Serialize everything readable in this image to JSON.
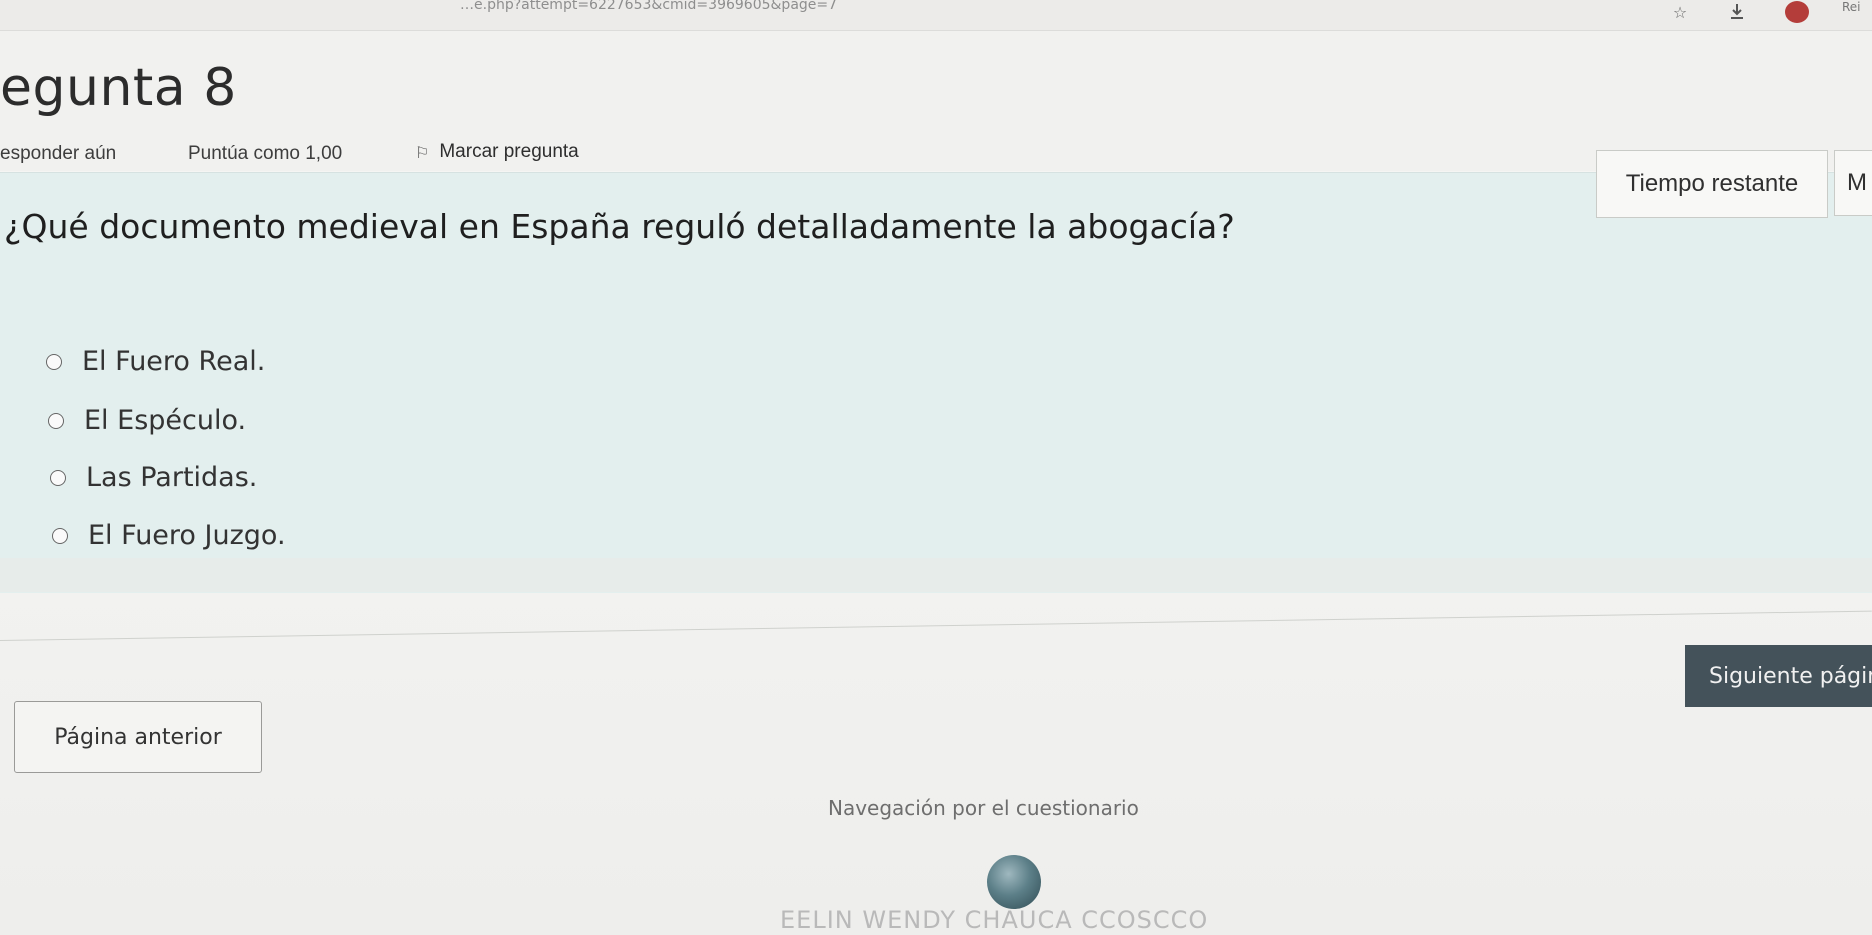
{
  "browser": {
    "url": "…e.php?attempt=6227653&cmid=3969605&page=7",
    "extra_label": "Rei"
  },
  "question": {
    "title": "egunta 8",
    "status": "esponder aún",
    "score": "Puntúa como 1,00",
    "flag_label": "Marcar pregunta",
    "text": "¿Qué documento medieval en España reguló detalladamente la abogacía?",
    "answers": [
      {
        "label": "El Fuero Real."
      },
      {
        "label": "El Espéculo."
      },
      {
        "label": "Las Partidas."
      },
      {
        "label": "El Fuero Juzgo."
      }
    ]
  },
  "timer": {
    "label": "Tiempo restante",
    "value": "M"
  },
  "navigation": {
    "prev_label": "Página anterior",
    "next_label": "Siguiente págin"
  },
  "quiz_nav": {
    "title": "Navegación por el cuestionario",
    "user_name": "EELIN WENDY CHAUCA CCOSCCO"
  },
  "icons": {
    "star": "star-icon",
    "download": "download-icon",
    "flag": "flag-icon",
    "radio": "radio-button"
  },
  "colors": {
    "card_bg": "#e3efee",
    "next_button_bg": "#44525a",
    "avatar_red": "#b43d3a"
  }
}
